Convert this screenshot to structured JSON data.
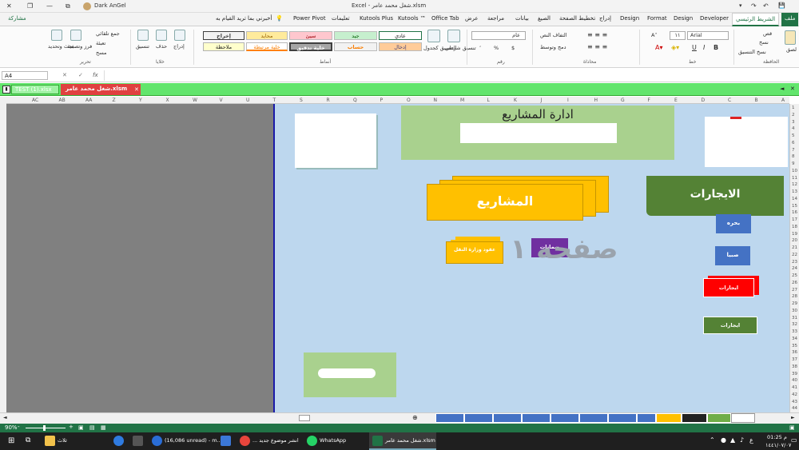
{
  "window": {
    "title": "Excel - شغل محمد عامر.xlsm",
    "user": "Dark AnGel",
    "minimize_glyph": "—",
    "restore_glyph": "❐",
    "close_glyph": "✕",
    "ribbon_options_glyph": "⧉",
    "qat_save_glyph": "💾",
    "qat_undo_glyph": "↶",
    "qat_redo_glyph": "↷",
    "qat_more_glyph": "▾"
  },
  "ribbon_tabs": {
    "file": "ملف",
    "home": "الشريط الرئيسي",
    "developer": "Developer",
    "design1": "Design",
    "format": "Format",
    "design2": "Design",
    "insert": "إدراج",
    "page_layout": "تخطيط الصفحة",
    "formulas": "الصيغ",
    "data": "بيانات",
    "review": "مراجعة",
    "view": "عرض",
    "office_tab": "Office Tab",
    "kutools": "Kutools ™",
    "kutools_plus": "Kutools Plus",
    "help": "تعليمات",
    "power_pivot": "Power Pivot",
    "tell_me": "أخبرني بما تريد القيام به",
    "share": "مشاركة"
  },
  "ribbon": {
    "clipboard": {
      "label": "الحافظة",
      "paste": "لصق",
      "cut": "قص",
      "copy": "نسخ",
      "format_painter": "نسخ التنسيق"
    },
    "font": {
      "label": "خط",
      "name": "Arial",
      "size": "١١",
      "bold": "B",
      "italic": "I",
      "underline": "U",
      "grow": "A˄",
      "shrink": "A˅"
    },
    "alignment": {
      "label": "محاذاة",
      "wrap": "التفاف النص",
      "merge": "دمج وتوسط"
    },
    "number": {
      "label": "رقم",
      "format": "عام",
      "currency": "$",
      "percent": "%",
      "comma": "٬"
    },
    "conditional": {
      "cond": "تنسيق شرطي",
      "table": "التنسيق كجدول"
    },
    "styles": {
      "label": "أنماط",
      "normal": "عادي",
      "good": "جيد",
      "bad": "سيئ",
      "neutral": "محايد",
      "output": "إخراج",
      "input": "إدخال",
      "calc": "حساب",
      "check": "خلية تدقيق",
      "linked": "خلية مرتبطة",
      "note": "ملاحظة"
    },
    "cells": {
      "label": "خلايا",
      "insert": "إدراج",
      "delete": "حذف",
      "format": "تنسيق"
    },
    "editing": {
      "label": "تحرير",
      "autosum": "جمع تلقائي",
      "fill": "تعبئة",
      "clear": "مسح",
      "sort": "فرز وتصفية",
      "find": "بحث وتحديد"
    }
  },
  "formula_bar": {
    "name_box": "A4",
    "cancel": "✕",
    "enter": "✓",
    "fx": "fx",
    "value": ""
  },
  "workbooks": {
    "tab1": "TEST (1).xlsx",
    "tab2": "شغل محمد عامر.xlsm",
    "close": "✕",
    "nav_left": "◄",
    "nav_right": "►"
  },
  "columns": [
    "A",
    "B",
    "C",
    "D",
    "E",
    "F",
    "G",
    "H",
    "I",
    "J",
    "K",
    "L",
    "M",
    "N",
    "O",
    "P",
    "Q",
    "R",
    "S",
    "T",
    "U",
    "V",
    "W",
    "X",
    "Y",
    "Z",
    "AA",
    "AB",
    "AC"
  ],
  "rows": [
    "1",
    "2",
    "3",
    "4",
    "5",
    "6",
    "7",
    "8",
    "9",
    "10",
    "11",
    "12",
    "13",
    "14",
    "15",
    "16",
    "17",
    "18",
    "19",
    "20",
    "21",
    "22",
    "23",
    "24",
    "25",
    "26",
    "27",
    "28",
    "29",
    "30",
    "31",
    "32",
    "33",
    "34",
    "35",
    "36",
    "37",
    "38",
    "39",
    "40",
    "41",
    "42",
    "43",
    "44"
  ],
  "dashboard": {
    "header_title": "ادارة المشاريع",
    "projects": "المشاريع",
    "rentals": "الايجارات",
    "contracts": "عقود وزارة النقل",
    "guarantees": "ضمانات",
    "watermark": "صفحه ١",
    "bahra": "بحره",
    "sabya": "صبيا",
    "rentals_red": "ايجارات",
    "rentals_green": "ايجارات"
  },
  "status": {
    "zoom": "90%",
    "zoom_minus": "-",
    "zoom_plus": "+"
  },
  "taskbar": {
    "explorer": "ثلاث",
    "mail": "(16,086 unread) - m...",
    "chrome": "... انشر موضوع جديد",
    "whatsapp": "WhatsApp",
    "excel": "شغل محمد عامر.xlsm",
    "time": "01:25 م",
    "date": "١٤٤١/٠٧/٠٧",
    "lang": "ع"
  },
  "colors": {
    "excel_green": "#217346",
    "canvas": "#bdd7ee",
    "yellow": "#ffc000",
    "green_dark": "#548235",
    "purple": "#7030a0",
    "blue": "#4472c4",
    "red": "#ff0000"
  }
}
